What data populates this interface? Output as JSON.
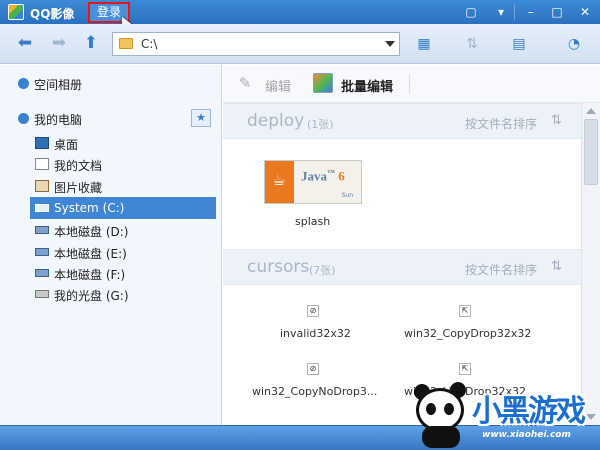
{
  "window": {
    "title": "QQ影像",
    "login_label": "登录",
    "controls": [
      "▢",
      "▾",
      "–",
      "□",
      "✕"
    ]
  },
  "toolbar": {
    "back_icon": "⬅",
    "forward_icon": "➡",
    "up_icon": "⬆",
    "address": "C:\\",
    "view_icon": "▦",
    "sort_icon": "⇅",
    "panel_icon": "▤",
    "share_icon": "◔"
  },
  "sidebar": {
    "space_album": "空间相册",
    "my_computer": "我的电脑",
    "star_icon": "★",
    "items": [
      {
        "label": "桌面",
        "icon": "desktop-icon"
      },
      {
        "label": "我的文档",
        "icon": "documents-icon"
      },
      {
        "label": "图片收藏",
        "icon": "pictures-icon"
      },
      {
        "label": "System (C:)",
        "icon": "disk-icon"
      },
      {
        "label": "本地磁盘 (D:)",
        "icon": "disk-icon"
      },
      {
        "label": "本地磁盘 (E:)",
        "icon": "disk-icon"
      },
      {
        "label": "本地磁盘 (F:)",
        "icon": "disk-icon"
      },
      {
        "label": "我的光盘 (G:)",
        "icon": "cd-icon"
      }
    ],
    "selected_index": 3
  },
  "main": {
    "edit_label": "编辑",
    "batch_edit_label": "批量编辑",
    "groups": [
      {
        "name": "deploy",
        "count": "(1张)",
        "sort_label": "按文件名排序",
        "files": [
          {
            "name": "splash",
            "thumb": {
              "word": "Java",
              "version": "6",
              "brand": "Sun"
            }
          }
        ]
      },
      {
        "name": "cursors",
        "count": "(7张)",
        "sort_label": "按文件名排序",
        "files": [
          {
            "name": "invalid32x32"
          },
          {
            "name": "win32_CopyDrop32x32"
          },
          {
            "name": "win32_CopyNoDrop3..."
          },
          {
            "name": "win32_LinkDrop32x32"
          }
        ]
      }
    ]
  },
  "watermark": {
    "brand": "小黑游戏",
    "url": "www.xiaohei.com"
  },
  "colors": {
    "title_bar": "#2a72c0",
    "selection": "#3f86d4",
    "login_border": "#e01a1a"
  }
}
